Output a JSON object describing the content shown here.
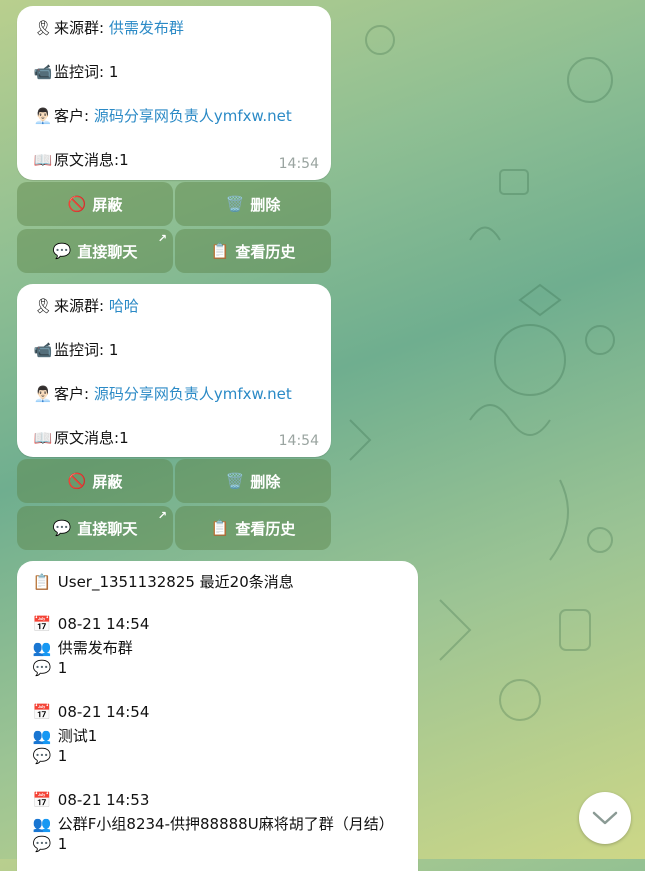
{
  "messages": [
    {
      "source_label": "来源群: ",
      "source_value": "供需发布群",
      "keyword_label": "监控词: ",
      "keyword_value": "1",
      "client_label": "客户: ",
      "client_value": "源码分享网负责人ymfxw.net",
      "original_label": "原文消息:",
      "original_value": "1",
      "time": "14:54",
      "buttons": {
        "block": "屏蔽",
        "delete": "删除",
        "chat": "直接聊天",
        "history": "查看历史"
      }
    },
    {
      "source_label": "来源群: ",
      "source_value": "哈哈",
      "keyword_label": "监控词: ",
      "keyword_value": "1",
      "client_label": "客户: ",
      "client_value": "源码分享网负责人ymfxw.net",
      "original_label": "原文消息:",
      "original_value": "1",
      "time": "14:54",
      "buttons": {
        "block": "屏蔽",
        "delete": "删除",
        "chat": "直接聊天",
        "history": "查看历史"
      }
    }
  ],
  "history": {
    "header": "User_1351132825 最近20条消息",
    "entries": [
      {
        "datetime": "08-21 14:54",
        "group": "供需发布群",
        "message": "1"
      },
      {
        "datetime": "08-21 14:54",
        "group": "测试1",
        "message": "1"
      },
      {
        "datetime": "08-21 14:53",
        "group": "公群F小组8234-供押88888U麻将胡了群（月结）",
        "message": "1"
      }
    ]
  },
  "icons": {
    "ribbon": "ribbon-icon",
    "camera": "video-camera-icon",
    "person": "person-icon",
    "book": "open-book-icon",
    "no-entry": "no-entry-icon",
    "trash": "trash-icon",
    "speech": "speech-bubble-icon",
    "clipboard": "clipboard-icon",
    "calendar": "calendar-icon",
    "users": "users-icon",
    "chevron": "chevron-down-icon"
  }
}
